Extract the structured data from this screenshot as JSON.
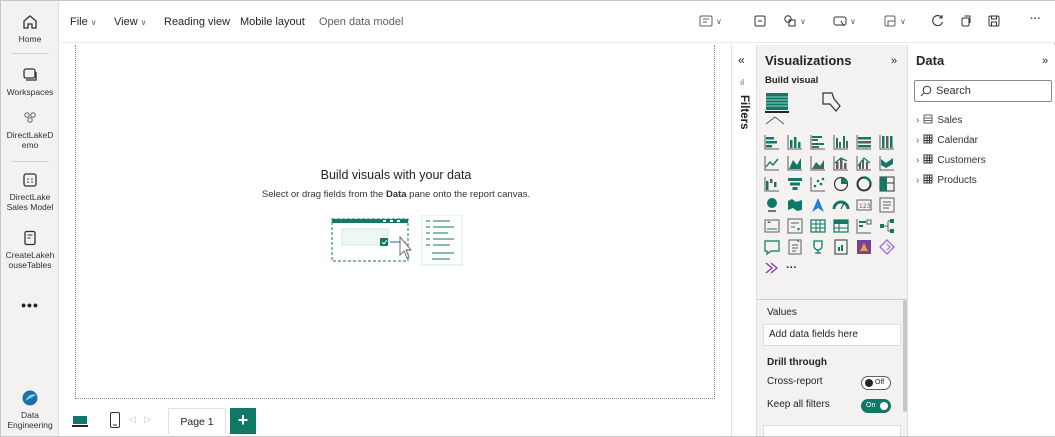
{
  "rail": {
    "items": [
      {
        "label": "Home",
        "icon": "home-icon"
      },
      {
        "label": "Workspaces",
        "icon": "workspaces-icon"
      },
      {
        "label": "DirectLakeDemo",
        "icon": "group-icon"
      },
      {
        "label": "DirectLake Sales Model",
        "icon": "semantic-model-icon"
      },
      {
        "label": "CreateLakehouseTables",
        "icon": "notebook-icon"
      }
    ],
    "more": "•••",
    "experience": "Data Engineering"
  },
  "menubar": {
    "file": "File",
    "view": "View",
    "reading_view": "Reading view",
    "mobile_layout": "Mobile layout",
    "open_data_model": "Open data model"
  },
  "canvas": {
    "empty_title": "Build visuals with your data",
    "empty_sub_prefix": "Select or drag fields from the ",
    "empty_sub_bold": "Data",
    "empty_sub_suffix": " pane onto the report canvas."
  },
  "pages": {
    "tabs": [
      "Page 1"
    ],
    "add_label": "+"
  },
  "filters": {
    "label": "Filters",
    "collapse": "«"
  },
  "visualizations": {
    "title": "Visualizations",
    "expand": "»",
    "build_visual": "Build visual",
    "more": "···",
    "values_label": "Values",
    "values_placeholder": "Add data fields here",
    "drill_through": "Drill through",
    "cross_report": "Cross-report",
    "cross_report_state": "Off",
    "keep_all_filters": "Keep all filters",
    "keep_all_filters_state": "On"
  },
  "data_pane": {
    "title": "Data",
    "expand": "»",
    "search_placeholder": "Search",
    "tables": [
      "Sales",
      "Calendar",
      "Customers",
      "Products"
    ]
  },
  "colors": {
    "accent": "#117865",
    "rail_bg": "#f3f2f1",
    "pane_bg": "#f3f2f1"
  }
}
